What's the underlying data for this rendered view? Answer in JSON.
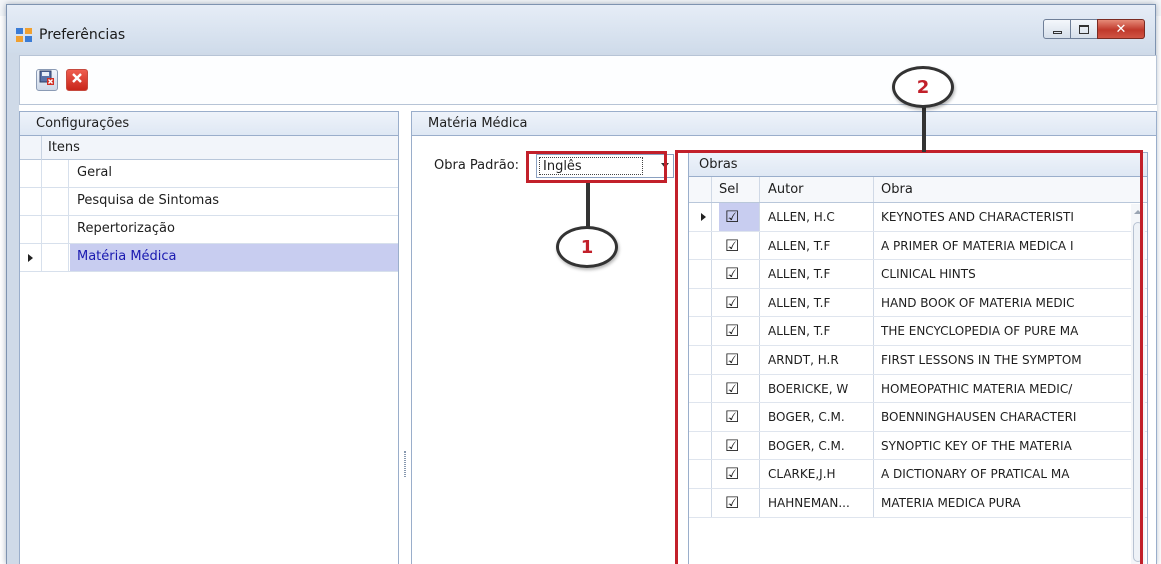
{
  "window": {
    "title": "Preferências"
  },
  "colors": {
    "selection": "#c8cdf0",
    "callout": "#c2202a",
    "panel_header": "#dfe8f4"
  },
  "configuracoes": {
    "header": "Configurações",
    "column": "Itens",
    "items": [
      {
        "label": "Geral",
        "selected": false
      },
      {
        "label": "Pesquisa de Sintomas",
        "selected": false
      },
      {
        "label": "Repertorização",
        "selected": false
      },
      {
        "label": "Matéria Médica",
        "selected": true
      }
    ]
  },
  "materia_medica": {
    "header": "Matéria Médica",
    "obra_padrao_label": "Obra Padrão:",
    "obra_padrao_value": "Inglês"
  },
  "obras": {
    "header": "Obras",
    "columns": [
      "Sel",
      "Autor",
      "Obra"
    ],
    "rows": [
      {
        "sel": true,
        "autor": "ALLEN, H.C",
        "obra": "KEYNOTES AND CHARACTERISTI"
      },
      {
        "sel": true,
        "autor": "ALLEN, T.F",
        "obra": "A PRIMER OF MATERIA MEDICA I"
      },
      {
        "sel": true,
        "autor": "ALLEN, T.F",
        "obra": "CLINICAL HINTS"
      },
      {
        "sel": true,
        "autor": "ALLEN, T.F",
        "obra": "HAND BOOK OF MATERIA MEDIC"
      },
      {
        "sel": true,
        "autor": "ALLEN, T.F",
        "obra": "THE ENCYCLOPEDIA OF PURE MA"
      },
      {
        "sel": true,
        "autor": "ARNDT, H.R",
        "obra": "FIRST LESSONS IN THE SYMPTOM"
      },
      {
        "sel": true,
        "autor": "BOERICKE, W",
        "obra": "HOMEOPATHIC MATERIA MEDIC/"
      },
      {
        "sel": true,
        "autor": "BOGER, C.M.",
        "obra": "BOENNINGHAUSEN CHARACTERI"
      },
      {
        "sel": true,
        "autor": "BOGER, C.M.",
        "obra": "SYNOPTIC KEY OF THE MATERIA"
      },
      {
        "sel": true,
        "autor": "CLARKE,J.H",
        "obra": "A DICTIONARY OF PRATICAL MA"
      },
      {
        "sel": true,
        "autor": "HAHNEMAN...",
        "obra": "MATERIA MEDICA PURA"
      }
    ]
  },
  "callouts": [
    "1",
    "2"
  ],
  "icons": {
    "app": "preferences-app-icon",
    "save": "save-close-icon",
    "cancel": "cancel-icon"
  }
}
